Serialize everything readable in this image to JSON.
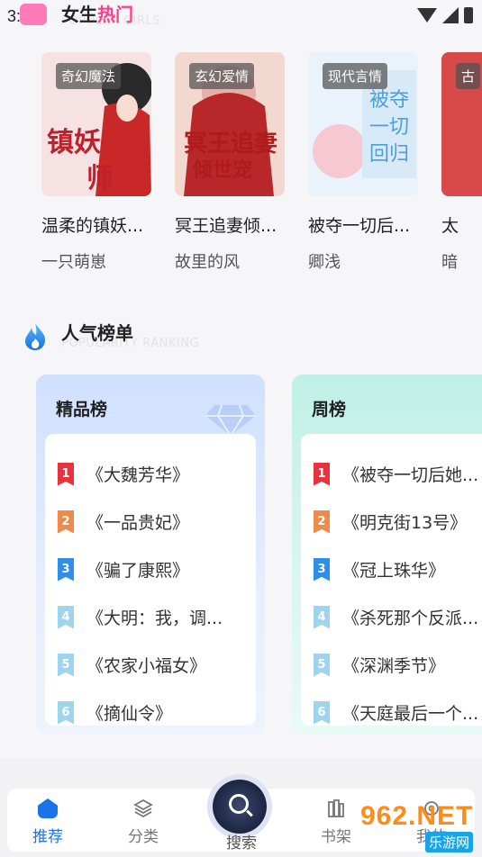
{
  "status_bar": {
    "time": "3:18"
  },
  "section_girls": {
    "title_prefix": "女生",
    "title_hot": "热门",
    "subtitle": "POPULAR GIRLS",
    "books": [
      {
        "tag": "奇幻魔法",
        "name": "温柔的镇妖...",
        "author": "一只萌崽",
        "cover_color": "#f3d6d6"
      },
      {
        "tag": "玄幻爱情",
        "name": "冥王追妻倾...",
        "author": "故里的风",
        "cover_color": "#f0cfc8"
      },
      {
        "tag": "现代言情",
        "name": "被夺一切后...",
        "author": "卿浅",
        "cover_color": "#e4eef8"
      },
      {
        "tag": "古",
        "name": "太",
        "author": "暗",
        "cover_color": "#d84a4a"
      }
    ]
  },
  "section_ranking": {
    "title": "人气榜单",
    "subtitle": "POPULARITY RANKING",
    "cards": [
      {
        "title": "精品榜",
        "items": [
          "《大魏芳华》",
          "《一品贵妃》",
          "《骗了康熙》",
          "《大明：我，调...",
          "《农家小福女》",
          "《摘仙令》"
        ]
      },
      {
        "title": "周榜",
        "items": [
          "《被夺一切后她...",
          "《明克街13号》",
          "《冠上珠华》",
          "《杀死那个反派...",
          "《深渊季节》",
          "《天庭最后一个..."
        ]
      }
    ]
  },
  "bottom_nav": {
    "items": [
      "推荐",
      "分类",
      "搜索",
      "书架",
      "我的"
    ],
    "active": "推荐"
  },
  "watermark": {
    "big": "962.NET",
    "small": "乐游网"
  },
  "colors": {
    "accent": "#1a73e8",
    "hot": "#ff3d8a"
  }
}
